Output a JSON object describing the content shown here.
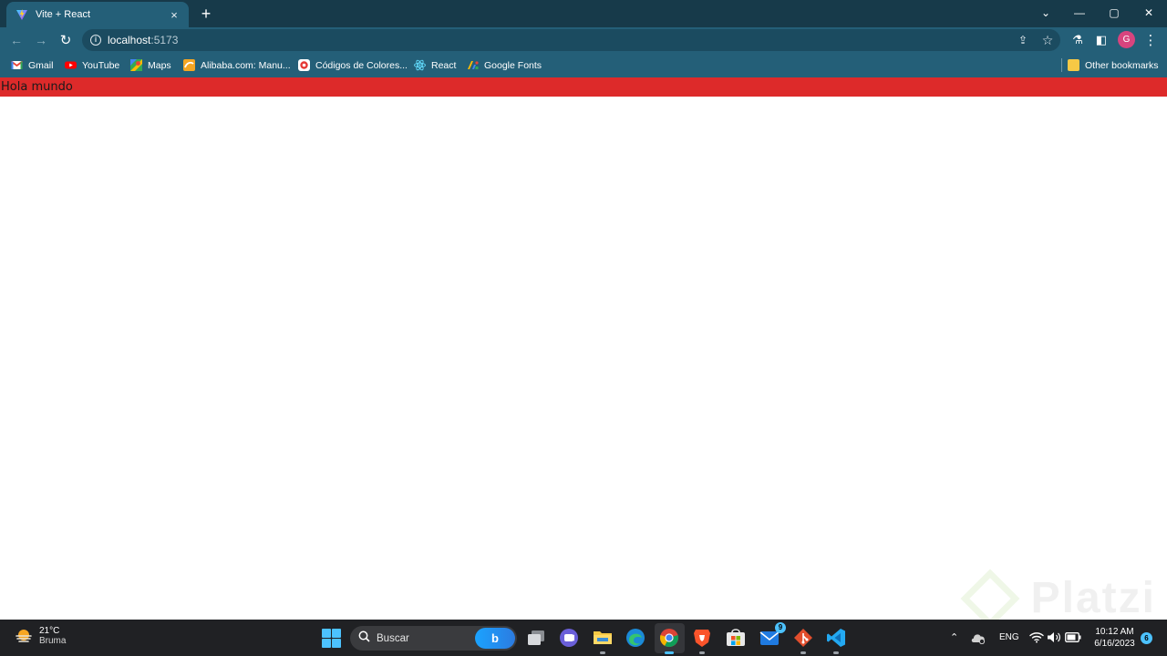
{
  "browser": {
    "tab": {
      "title": "Vite + React",
      "favicon": "vite-icon",
      "close": "×"
    },
    "new_tab": "+",
    "window_controls": {
      "list": "⌄",
      "minimize": "—",
      "restore": "▢",
      "close": "✕"
    },
    "toolbar": {
      "back": "←",
      "forward": "→",
      "reload": "↻",
      "url_host": "localhost",
      "url_port": ":5173",
      "share": "⇪",
      "star": "☆",
      "labs": "⚗",
      "sidepanel": "◧",
      "profile_initial": "G",
      "menu": "⋮"
    },
    "bookmarks": [
      {
        "label": "Gmail",
        "icon": "gmail-icon",
        "color": "#ea4335"
      },
      {
        "label": "YouTube",
        "icon": "youtube-icon",
        "color": "#ff0000"
      },
      {
        "label": "Maps",
        "icon": "maps-icon",
        "color": "#34a853"
      },
      {
        "label": "Alibaba.com: Manu...",
        "icon": "alibaba-icon",
        "color": "#f5a623"
      },
      {
        "label": "Códigos de Colores...",
        "icon": "colors-icon",
        "color": "#e53935"
      },
      {
        "label": "React",
        "icon": "react-icon",
        "color": "#61dafb"
      },
      {
        "label": "Google Fonts",
        "icon": "google-fonts-icon",
        "color": "#fbbc04"
      }
    ],
    "other_bookmarks": "Other bookmarks"
  },
  "page": {
    "heading": "Hola mundo",
    "heading_background": "#dd2a2a",
    "watermark": "Platzi"
  },
  "taskbar": {
    "weather": {
      "temp": "21°C",
      "condition": "Bruma"
    },
    "search_placeholder": "Buscar",
    "bing_label": "b",
    "store_badge": "9",
    "tray": {
      "language": "ENG",
      "time": "10:12 AM",
      "date": "6/16/2023",
      "notifications": "6"
    }
  }
}
